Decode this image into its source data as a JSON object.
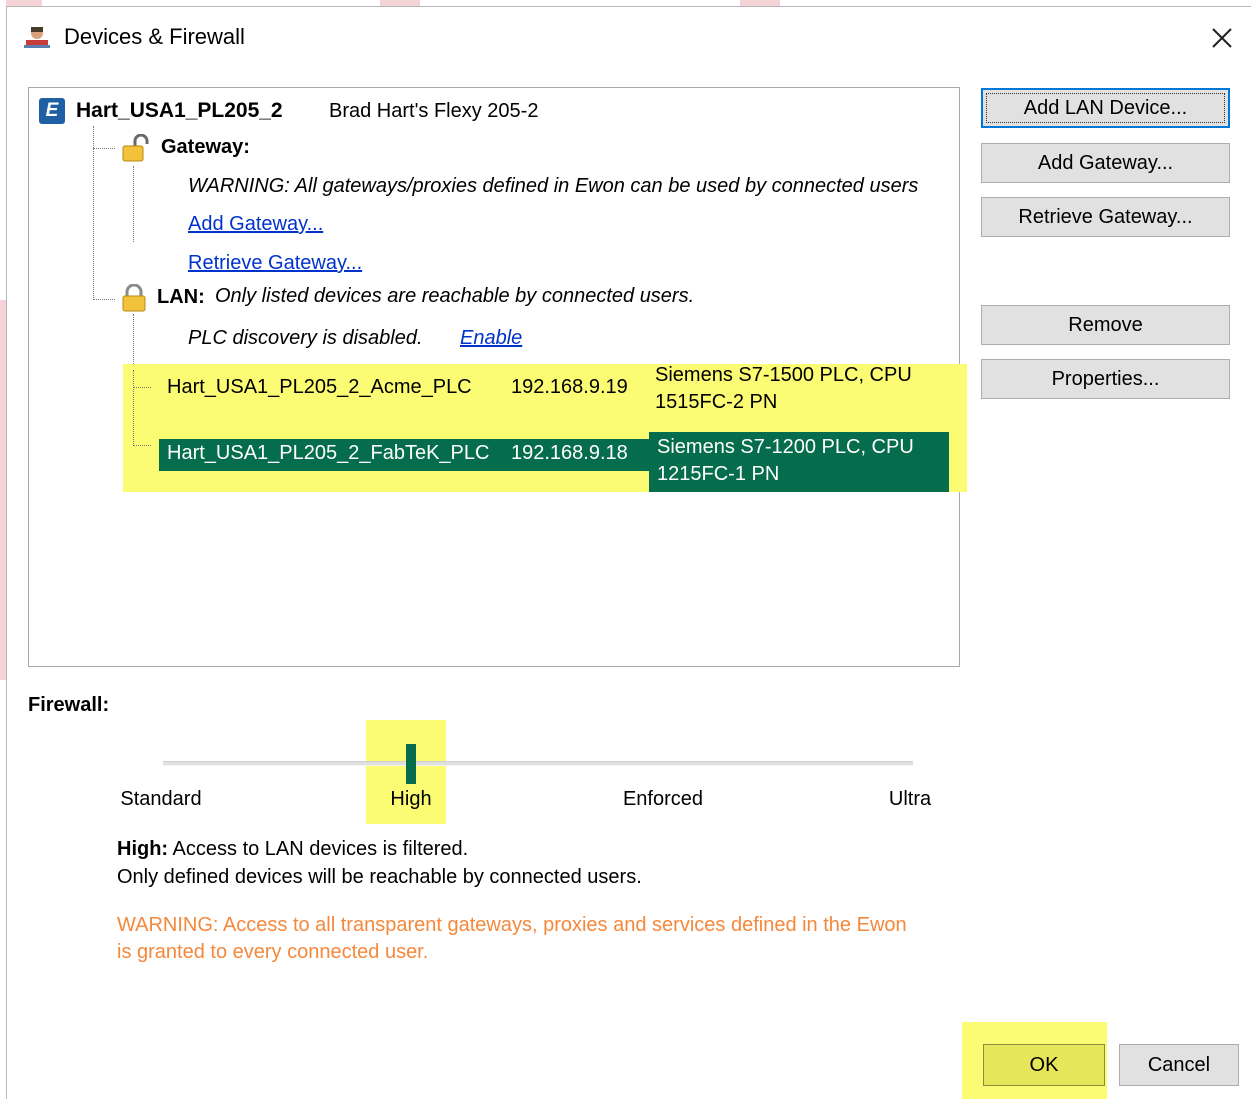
{
  "window": {
    "title": "Devices & Firewall",
    "icon": "user-network-icon",
    "close_icon": "close-icon"
  },
  "tree": {
    "device": {
      "icon": "ewon-e-icon",
      "icon_letter": "E",
      "name": "Hart_USA1_PL205_2",
      "description": "Brad Hart's Flexy 205-2"
    },
    "gateway": {
      "icon": "unlocked-padlock-icon",
      "label": "Gateway:",
      "warning": "WARNING: All gateways/proxies defined in Ewon can be used by connected users",
      "add_link": "Add Gateway...",
      "retrieve_link": "Retrieve Gateway..."
    },
    "lan": {
      "icon": "padlock-icon",
      "label": "LAN:",
      "note": "Only listed devices are reachable by connected users.",
      "discovery_text": "PLC discovery is disabled.",
      "enable_link": "Enable",
      "devices": [
        {
          "name": "Hart_USA1_PL205_2_Acme_PLC",
          "ip": "192.168.9.19",
          "type_line1": "Siemens S7-1500 PLC, CPU",
          "type_line2": "1515FC-2 PN",
          "selected": false
        },
        {
          "name": "Hart_USA1_PL205_2_FabTeK_PLC",
          "ip": "192.168.9.18",
          "type_line1": "Siemens S7-1200 PLC, CPU",
          "type_line2": "1215FC-1 PN",
          "selected": true
        }
      ]
    }
  },
  "buttons": {
    "add_lan_device": "Add LAN Device...",
    "add_gateway": "Add Gateway...",
    "retrieve_gateway": "Retrieve Gateway...",
    "remove": "Remove",
    "properties": "Properties...",
    "ok": "OK",
    "cancel": "Cancel"
  },
  "firewall": {
    "title": "Firewall:",
    "levels": [
      "Standard",
      "High",
      "Enforced",
      "Ultra"
    ],
    "selected_level": "High",
    "description_bold": "High:",
    "description_rest": "Access to LAN devices is filtered.",
    "description_line2": "Only defined devices will be reachable by connected users.",
    "warning_line1": "WARNING: Access to all transparent gateways, proxies and services defined in the Ewon",
    "warning_line2": "is granted to every connected user."
  },
  "colors": {
    "selection": "#066d4c",
    "highlight": "#fbfb74",
    "link": "#0033cc",
    "warning": "#f5883b",
    "accent_red": "#f4d4d6"
  }
}
